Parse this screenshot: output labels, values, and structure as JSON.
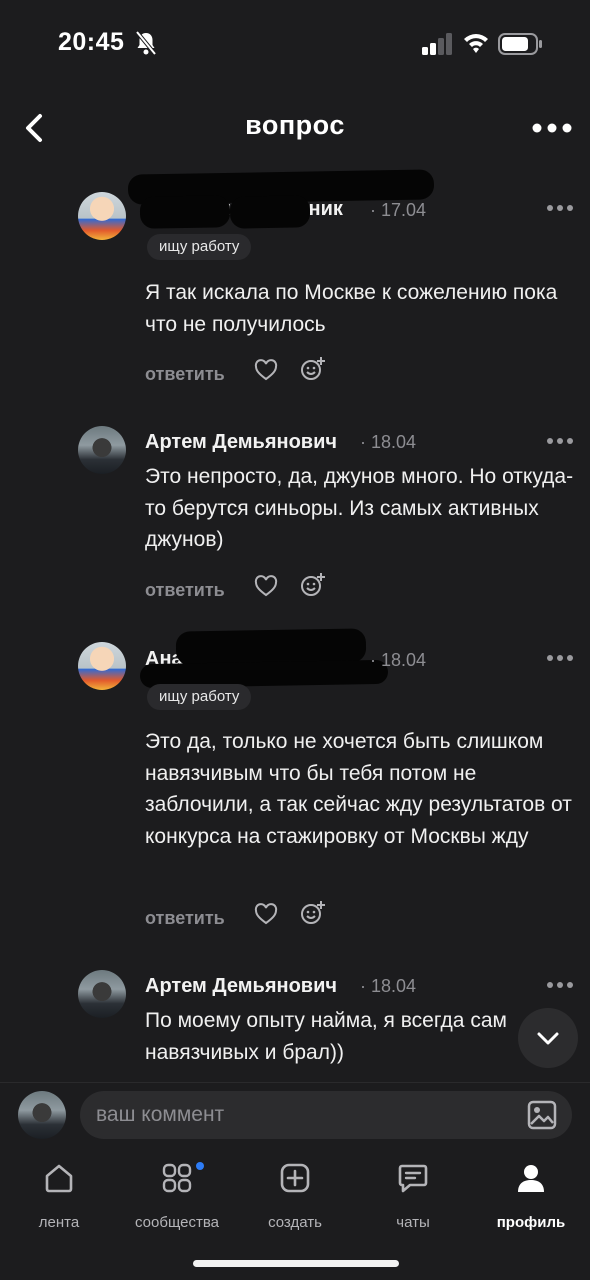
{
  "status_bar": {
    "time": "20:45"
  },
  "header": {
    "title": "вопрос"
  },
  "comments": [
    {
      "author": "Анастасия Шкурник",
      "date": "· 17.04",
      "tag": "ищу работу",
      "text": "Я так искала по Москве к сожелению пока что не получилось",
      "reply_label": "ответить"
    },
    {
      "author": "Артем Демьянович",
      "date": "· 18.04",
      "tag": "",
      "text": "Это непросто, да, джунов много. Но откуда-то берутся синьоры. Из самых активных джунов)",
      "reply_label": "ответить"
    },
    {
      "author": "Анастасия Шкурник",
      "date": "· 18.04",
      "tag": "ищу работу",
      "text": "Это да, только не хочется быть слишком навязчивым  что бы тебя потом не заблочили, а так сейчас жду результатов от конкурса на стажировку от Москвы жду",
      "reply_label": "ответить"
    },
    {
      "author": "Артем Демьянович",
      "date": "· 18.04",
      "tag": "",
      "text": "По моему опыту найма, я всегда сам навязчивых и брал))",
      "reply_label": ""
    }
  ],
  "composer": {
    "placeholder": "ваш коммент"
  },
  "tabbar": [
    {
      "label": "лента",
      "icon": "home-icon"
    },
    {
      "label": "сообщества",
      "icon": "communities-icon"
    },
    {
      "label": "создать",
      "icon": "create-icon"
    },
    {
      "label": "чаты",
      "icon": "chats-icon"
    },
    {
      "label": "профиль",
      "icon": "profile-icon"
    }
  ],
  "colors": {
    "background": "#1c1c1e",
    "muted": "#8d8d92",
    "badge_dot": "#2d7cf6"
  }
}
